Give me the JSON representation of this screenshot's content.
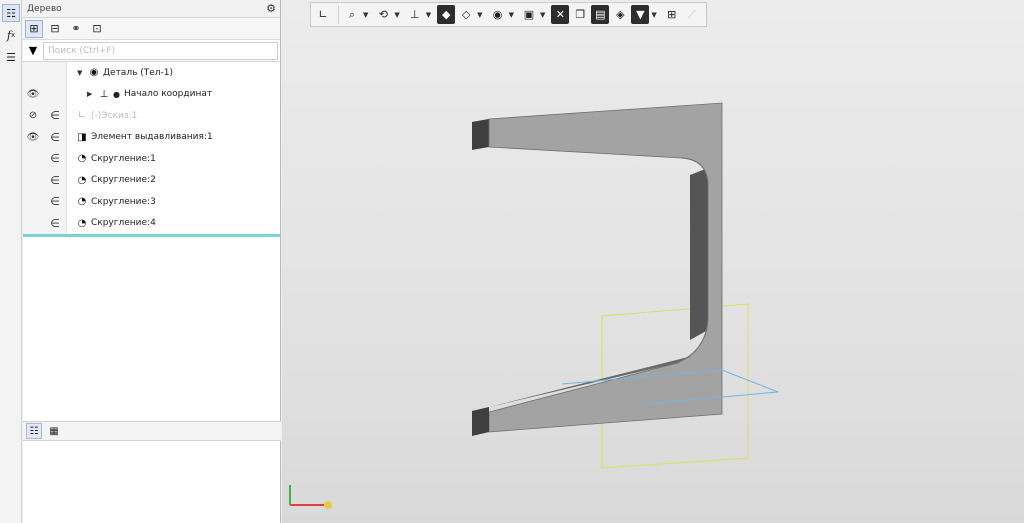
{
  "panel": {
    "title": "Дерево",
    "filter_placeholder": "Поиск (Ctrl+F)"
  },
  "tree": {
    "root": "Деталь (Тел-1)",
    "items": [
      {
        "label": "Начало координат",
        "muted": false,
        "eye": "visible"
      },
      {
        "label": "Эскиз:1",
        "muted": true,
        "eye": "hidden"
      },
      {
        "label": "Элемент выдавливания:1",
        "muted": false,
        "eye": "visible"
      },
      {
        "label": "Скругление:1",
        "muted": false,
        "eye": "none"
      },
      {
        "label": "Скругление:2",
        "muted": false,
        "eye": "none"
      },
      {
        "label": "Скругление:3",
        "muted": false,
        "eye": "none"
      },
      {
        "label": "Скругление:4",
        "muted": false,
        "eye": "none"
      }
    ],
    "sketch_prefix": "(-)"
  },
  "icons": {
    "left_strip": [
      "tree-icon",
      "fx-icon",
      "list-icon"
    ],
    "panel_tools": [
      "tree-structure-icon",
      "tree-structure-alt-icon",
      "link-icon",
      "group-icon"
    ],
    "bottom_tabs": [
      "tree-icon",
      "table-icon"
    ],
    "viewport_toolbar": [
      "coordinate-system-icon",
      "zoom-icon",
      "rotate-icon",
      "axis-icon",
      "shaded-view-icon",
      "wireframe-view-icon",
      "visibility-icon",
      "section-icon",
      "snap-icon",
      "window-icon",
      "view-mode-icon",
      "render-icon",
      "filter-icon",
      "layout-icon"
    ]
  },
  "colors": {
    "accent_line": "#7ad3d9",
    "bbox_yellow": "#d8e35a",
    "bbox_blue": "#6fb6e6",
    "model_face": "#9e9e9e",
    "model_dark": "#5c5c5c"
  }
}
